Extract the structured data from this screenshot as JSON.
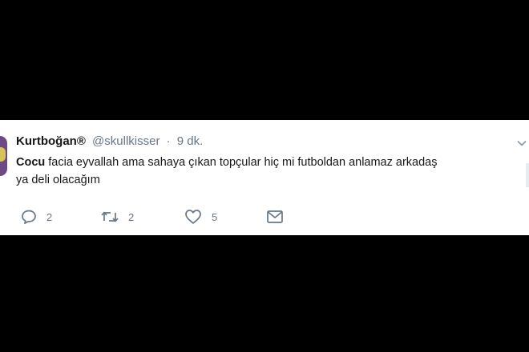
{
  "tweet": {
    "author_name": "Kurtboğan®",
    "handle": "@skullkisser",
    "separator": "·",
    "time": "9 dk.",
    "text_mention": "Cocu",
    "text_line1": " facia eyvallah ama sahaya çıkan topçular hiç mi futboldan anlamaz arkadaş",
    "text_line2": "ya deli olacağım"
  },
  "actions": {
    "reply": {
      "icon": "reply-icon",
      "count": "2"
    },
    "retweet": {
      "icon": "retweet-icon",
      "count": "2"
    },
    "like": {
      "icon": "heart-icon",
      "count": "5"
    },
    "message": {
      "icon": "envelope-icon"
    }
  },
  "colors": {
    "background": "#000000",
    "card": "#ffffff",
    "text": "#14171a",
    "muted": "#657786"
  }
}
